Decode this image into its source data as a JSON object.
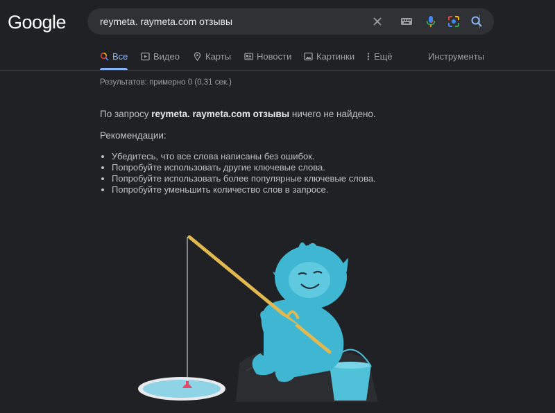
{
  "header": {
    "logo_text": "Google",
    "search": {
      "value": "reymeta. raymeta.com отзывы"
    }
  },
  "icons": {
    "clear": "close-icon",
    "keyboard": "keyboard-icon",
    "voice": "microphone-icon",
    "lens": "camera-lens-icon",
    "search": "search-icon"
  },
  "tabs": [
    {
      "label": "Все",
      "icon": "search-icon",
      "active": true
    },
    {
      "label": "Видео",
      "icon": "play-icon"
    },
    {
      "label": "Карты",
      "icon": "map-pin-icon"
    },
    {
      "label": "Новости",
      "icon": "newspaper-icon"
    },
    {
      "label": "Картинки",
      "icon": "image-icon"
    },
    {
      "label": "Ещё",
      "icon": "more-vert-icon"
    }
  ],
  "tools_label": "Инструменты",
  "results": {
    "stats": "Результатов: примерно 0 (0,31 сек.)",
    "no_results_prefix": "По запросу ",
    "no_results_query": "reymeta. raymeta.com отзывы",
    "no_results_suffix": " ничего не найдено.",
    "recommendations_title": "Рекомендации:",
    "recommendations": [
      "Убедитесь, что все слова написаны без ошибок.",
      "Попробуйте использовать другие ключевые слова.",
      "Попробуйте использовать более популярные ключевые слова.",
      "Попробуйте уменьшить количество слов в запросе."
    ]
  },
  "colors": {
    "background": "#202124",
    "accent": "#8ab4f8",
    "yeti": "#3fb7d3",
    "rod": "#e2b94f",
    "bucket": "#4fc1d9"
  }
}
